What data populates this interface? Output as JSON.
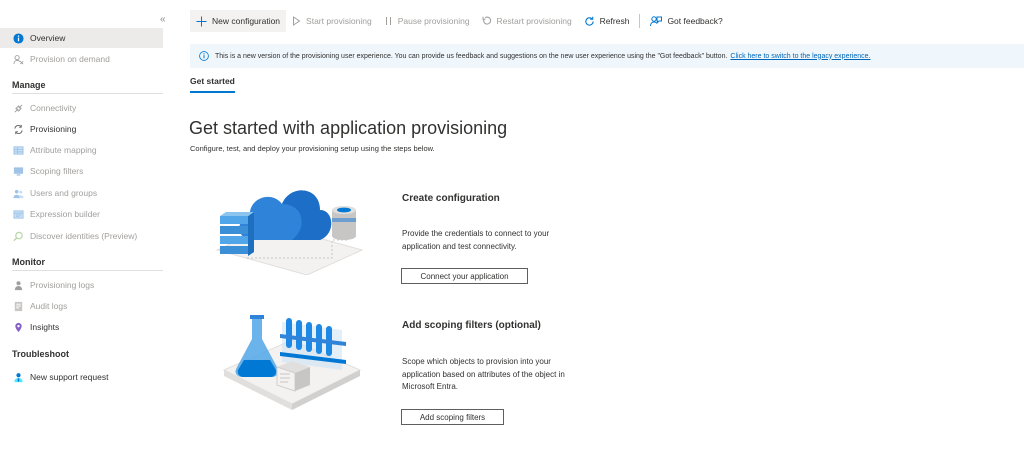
{
  "sidebar": {
    "collapse_glyph": "«",
    "items_top": [
      {
        "label": "Overview",
        "icon": "info-icon",
        "selected": true
      },
      {
        "label": "Provision on demand",
        "icon": "provision-on-demand-icon",
        "disabled": true
      }
    ],
    "sections": [
      {
        "title": "Manage",
        "items": [
          {
            "label": "Connectivity",
            "icon": "connectivity-icon",
            "disabled": true
          },
          {
            "label": "Provisioning",
            "icon": "provisioning-icon",
            "disabled": false
          },
          {
            "label": "Attribute mapping",
            "icon": "attribute-mapping-icon",
            "disabled": true
          },
          {
            "label": "Scoping filters",
            "icon": "scoping-filters-icon",
            "disabled": true
          },
          {
            "label": "Users and groups",
            "icon": "users-groups-icon",
            "disabled": true
          },
          {
            "label": "Expression builder",
            "icon": "expression-builder-icon",
            "disabled": true
          },
          {
            "label": "Discover identities (Preview)",
            "icon": "discover-identities-icon",
            "disabled": true
          }
        ]
      },
      {
        "title": "Monitor",
        "items": [
          {
            "label": "Provisioning logs",
            "icon": "provisioning-logs-icon",
            "disabled": true
          },
          {
            "label": "Audit logs",
            "icon": "audit-logs-icon",
            "disabled": true
          },
          {
            "label": "Insights",
            "icon": "insights-icon",
            "disabled": false
          }
        ]
      },
      {
        "title": "Troubleshoot",
        "items": [
          {
            "label": "New support request",
            "icon": "support-request-icon",
            "disabled": false
          }
        ]
      }
    ]
  },
  "toolbar": {
    "new_configuration": "New configuration",
    "start_provisioning": "Start provisioning",
    "pause_provisioning": "Pause provisioning",
    "restart_provisioning": "Restart provisioning",
    "refresh": "Refresh",
    "got_feedback": "Got feedback?"
  },
  "banner": {
    "text": "This is a new version of the provisioning user experience. You can provide us feedback and suggestions on the new user experience using the \"Got feedback\" button.",
    "link": "Click here to switch to the legacy experience."
  },
  "tabs": {
    "get_started": "Get started"
  },
  "main": {
    "title": "Get started with application provisioning",
    "subtitle": "Configure, test, and deploy your provisioning setup using the steps below.",
    "cards": [
      {
        "title": "Create configuration",
        "description": "Provide the credentials to connect to your application and test connectivity.",
        "button": "Connect your application"
      },
      {
        "title": "Add scoping filters (optional)",
        "description": "Scope which objects to provision into your application based on attributes of the object in Microsoft Entra.",
        "button": "Add scoping filters"
      }
    ]
  },
  "colors": {
    "accent": "#0078d4",
    "link": "#0067b8",
    "banner_bg": "#eff6fc",
    "selected_bg": "#edebe9",
    "disabled_text": "#a19f9d"
  }
}
